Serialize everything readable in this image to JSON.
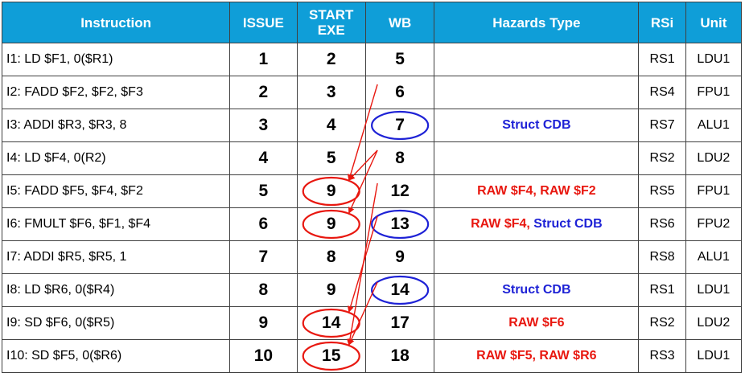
{
  "headers": [
    "Instruction",
    "ISSUE",
    "START EXE",
    "WB",
    "Hazards Type",
    "RSi",
    "Unit"
  ],
  "header_lines": {
    "start_exe_1": "START",
    "start_exe_2": "EXE"
  },
  "rows": [
    {
      "instr": "I1: LD $F1, 0($R1)",
      "issue": "1",
      "start": "2",
      "wb": "5",
      "haz": [],
      "rs": "RS1",
      "unit": "LDU1"
    },
    {
      "instr": "I2: FADD $F2, $F2, $F3",
      "issue": "2",
      "start": "3",
      "wb": "6",
      "haz": [],
      "rs": "RS4",
      "unit": "FPU1"
    },
    {
      "instr": "I3: ADDI $R3, $R3, 8",
      "issue": "3",
      "start": "4",
      "wb": "7",
      "haz": [
        {
          "text": "Struct CDB",
          "color": "blue"
        }
      ],
      "rs": "RS7",
      "unit": "ALU1"
    },
    {
      "instr": "I4: LD $F4, 0(R2)",
      "issue": "4",
      "start": "5",
      "wb": "8",
      "haz": [],
      "rs": "RS2",
      "unit": "LDU2"
    },
    {
      "instr": "I5: FADD $F5, $F4, $F2",
      "issue": "5",
      "start": "9",
      "wb": "12",
      "haz": [
        {
          "text": "RAW $F4, RAW $F2",
          "color": "red"
        }
      ],
      "rs": "RS5",
      "unit": "FPU1"
    },
    {
      "instr": "I6: FMULT $F6, $F1, $F4",
      "issue": "6",
      "start": "9",
      "wb": "13",
      "haz": [
        {
          "text": "RAW $F4, ",
          "color": "red"
        },
        {
          "text": "Struct CDB",
          "color": "blue"
        }
      ],
      "rs": "RS6",
      "unit": "FPU2"
    },
    {
      "instr": "I7: ADDI $R5, $R5, 1",
      "issue": "7",
      "start": "8",
      "wb": "9",
      "haz": [],
      "rs": "RS8",
      "unit": "ALU1"
    },
    {
      "instr": "I8: LD $R6, 0($R4)",
      "issue": "8",
      "start": "9",
      "wb": "14",
      "haz": [
        {
          "text": "Struct CDB",
          "color": "blue"
        }
      ],
      "rs": "RS1",
      "unit": "LDU1"
    },
    {
      "instr": "I9: SD $F6, 0($R5)",
      "issue": "9",
      "start": "14",
      "wb": "17",
      "haz": [
        {
          "text": "RAW $F6",
          "color": "red"
        }
      ],
      "rs": "RS2",
      "unit": "LDU2"
    },
    {
      "instr": "I10: SD $F5, 0($R6)",
      "issue": "10",
      "start": "15",
      "wb": "18",
      "haz": [
        {
          "text": "RAW $F5, RAW $R6",
          "color": "red"
        }
      ],
      "rs": "RS3",
      "unit": "LDU1"
    }
  ],
  "colors": {
    "header_bg": "#0f9ed8",
    "red": "#e8170f",
    "blue": "#1e22d6"
  },
  "annotations": {
    "circles": [
      {
        "row": 2,
        "col": "wb",
        "color": "blue"
      },
      {
        "row": 4,
        "col": "start",
        "color": "red"
      },
      {
        "row": 5,
        "col": "start",
        "color": "red"
      },
      {
        "row": 5,
        "col": "wb",
        "color": "blue"
      },
      {
        "row": 7,
        "col": "wb",
        "color": "blue"
      },
      {
        "row": 8,
        "col": "start",
        "color": "red"
      },
      {
        "row": 9,
        "col": "start",
        "color": "red"
      }
    ],
    "arrows": [
      {
        "from": {
          "row": 1,
          "col": "wb"
        },
        "to": {
          "row": 4,
          "col": "start"
        }
      },
      {
        "from": {
          "row": 3,
          "col": "wb"
        },
        "to": {
          "row": 4,
          "col": "start"
        }
      },
      {
        "from": {
          "row": 3,
          "col": "wb"
        },
        "to": {
          "row": 5,
          "col": "start"
        }
      },
      {
        "from": {
          "row": 5,
          "col": "wb"
        },
        "to": {
          "row": 8,
          "col": "start"
        }
      },
      {
        "from": {
          "row": 4,
          "col": "wb"
        },
        "to": {
          "row": 9,
          "col": "start"
        }
      },
      {
        "from": {
          "row": 7,
          "col": "wb"
        },
        "to": {
          "row": 9,
          "col": "start"
        }
      }
    ]
  }
}
